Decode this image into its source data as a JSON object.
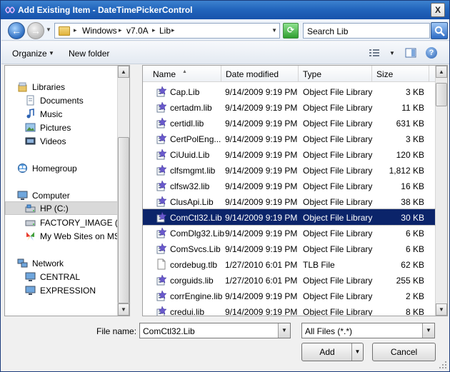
{
  "window": {
    "title": "Add Existing Item - DateTimePickerControl",
    "close_label": "X"
  },
  "address_bar": {
    "breadcrumbs": [
      "Windows",
      "v7.0A",
      "Lib"
    ],
    "separator": "▸",
    "search_placeholder": "Search Lib"
  },
  "command_bar": {
    "organize_label": "Organize",
    "new_folder_label": "New folder",
    "help_label": "?"
  },
  "navigation": {
    "libraries_header": "Libraries",
    "libraries": [
      "Documents",
      "Music",
      "Pictures",
      "Videos"
    ],
    "homegroup": "Homegroup",
    "computer_header": "Computer",
    "drives": [
      "HP (C:)",
      "FACTORY_IMAGE (D:)",
      "My Web Sites on MSN"
    ],
    "network_header": "Network",
    "network_items": [
      "CENTRAL",
      "EXPRESSION"
    ]
  },
  "file_list": {
    "columns": [
      "Name",
      "Date modified",
      "Type",
      "Size"
    ],
    "selected_index": 8,
    "rows": [
      {
        "name": "Cap.Lib",
        "date": "9/14/2009 9:19 PM",
        "type": "Object File Library",
        "size": "3 KB",
        "icon": "library"
      },
      {
        "name": "certadm.lib",
        "date": "9/14/2009 9:19 PM",
        "type": "Object File Library",
        "size": "11 KB",
        "icon": "library"
      },
      {
        "name": "certidl.lib",
        "date": "9/14/2009 9:19 PM",
        "type": "Object File Library",
        "size": "631 KB",
        "icon": "library"
      },
      {
        "name": "CertPolEng...",
        "date": "9/14/2009 9:19 PM",
        "type": "Object File Library",
        "size": "3 KB",
        "icon": "library"
      },
      {
        "name": "CiUuid.Lib",
        "date": "9/14/2009 9:19 PM",
        "type": "Object File Library",
        "size": "120 KB",
        "icon": "library"
      },
      {
        "name": "clfsmgmt.lib",
        "date": "9/14/2009 9:19 PM",
        "type": "Object File Library",
        "size": "1,812 KB",
        "icon": "library"
      },
      {
        "name": "clfsw32.lib",
        "date": "9/14/2009 9:19 PM",
        "type": "Object File Library",
        "size": "16 KB",
        "icon": "library"
      },
      {
        "name": "ClusApi.Lib",
        "date": "9/14/2009 9:19 PM",
        "type": "Object File Library",
        "size": "38 KB",
        "icon": "library"
      },
      {
        "name": "ComCtl32.Lib",
        "date": "9/14/2009 9:19 PM",
        "type": "Object File Library",
        "size": "30 KB",
        "icon": "library"
      },
      {
        "name": "ComDlg32.Lib",
        "date": "9/14/2009 9:19 PM",
        "type": "Object File Library",
        "size": "6 KB",
        "icon": "library"
      },
      {
        "name": "ComSvcs.Lib",
        "date": "9/14/2009 9:19 PM",
        "type": "Object File Library",
        "size": "6 KB",
        "icon": "library"
      },
      {
        "name": "cordebug.tlb",
        "date": "1/27/2010 6:01 PM",
        "type": "TLB File",
        "size": "62 KB",
        "icon": "blank"
      },
      {
        "name": "corguids.lib",
        "date": "1/27/2010 6:01 PM",
        "type": "Object File Library",
        "size": "255 KB",
        "icon": "library"
      },
      {
        "name": "corrEngine.lib",
        "date": "9/14/2009 9:19 PM",
        "type": "Object File Library",
        "size": "2 KB",
        "icon": "library"
      },
      {
        "name": "credui.lib",
        "date": "9/14/2009 9:19 PM",
        "type": "Object File Library",
        "size": "8 KB",
        "icon": "library"
      }
    ]
  },
  "footer": {
    "file_name_label": "File name:",
    "file_name_value": "ComCtl32.Lib",
    "file_type_value": "All Files (*.*)",
    "add_label": "Add",
    "cancel_label": "Cancel"
  },
  "colors": {
    "selection": "#0b246a",
    "titlebar": "#2366bd"
  }
}
